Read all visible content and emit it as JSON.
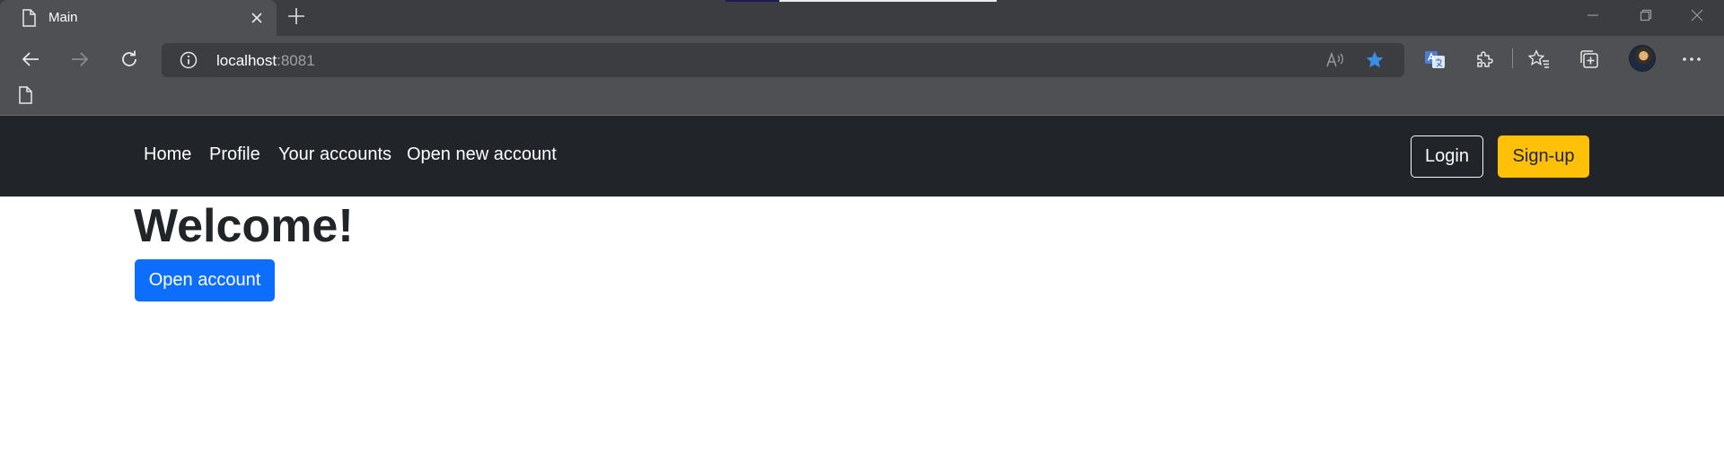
{
  "browser": {
    "tab": {
      "title": "Main"
    },
    "address": {
      "host": "localhost",
      "port": ":8081"
    },
    "window_controls": [
      "minimize",
      "restore",
      "close"
    ],
    "colors": {
      "favorite_star": "#3a8ee6",
      "accent_blue": "#0d6efd"
    }
  },
  "navbar": {
    "links": [
      "Home",
      "Profile",
      "Your accounts",
      "Open new account"
    ],
    "login_label": "Login",
    "signup_label": "Sign-up",
    "colors": {
      "background": "#212529",
      "signup_bg": "#ffc107"
    }
  },
  "main": {
    "heading": "Welcome!",
    "open_account_label": "Open account"
  }
}
